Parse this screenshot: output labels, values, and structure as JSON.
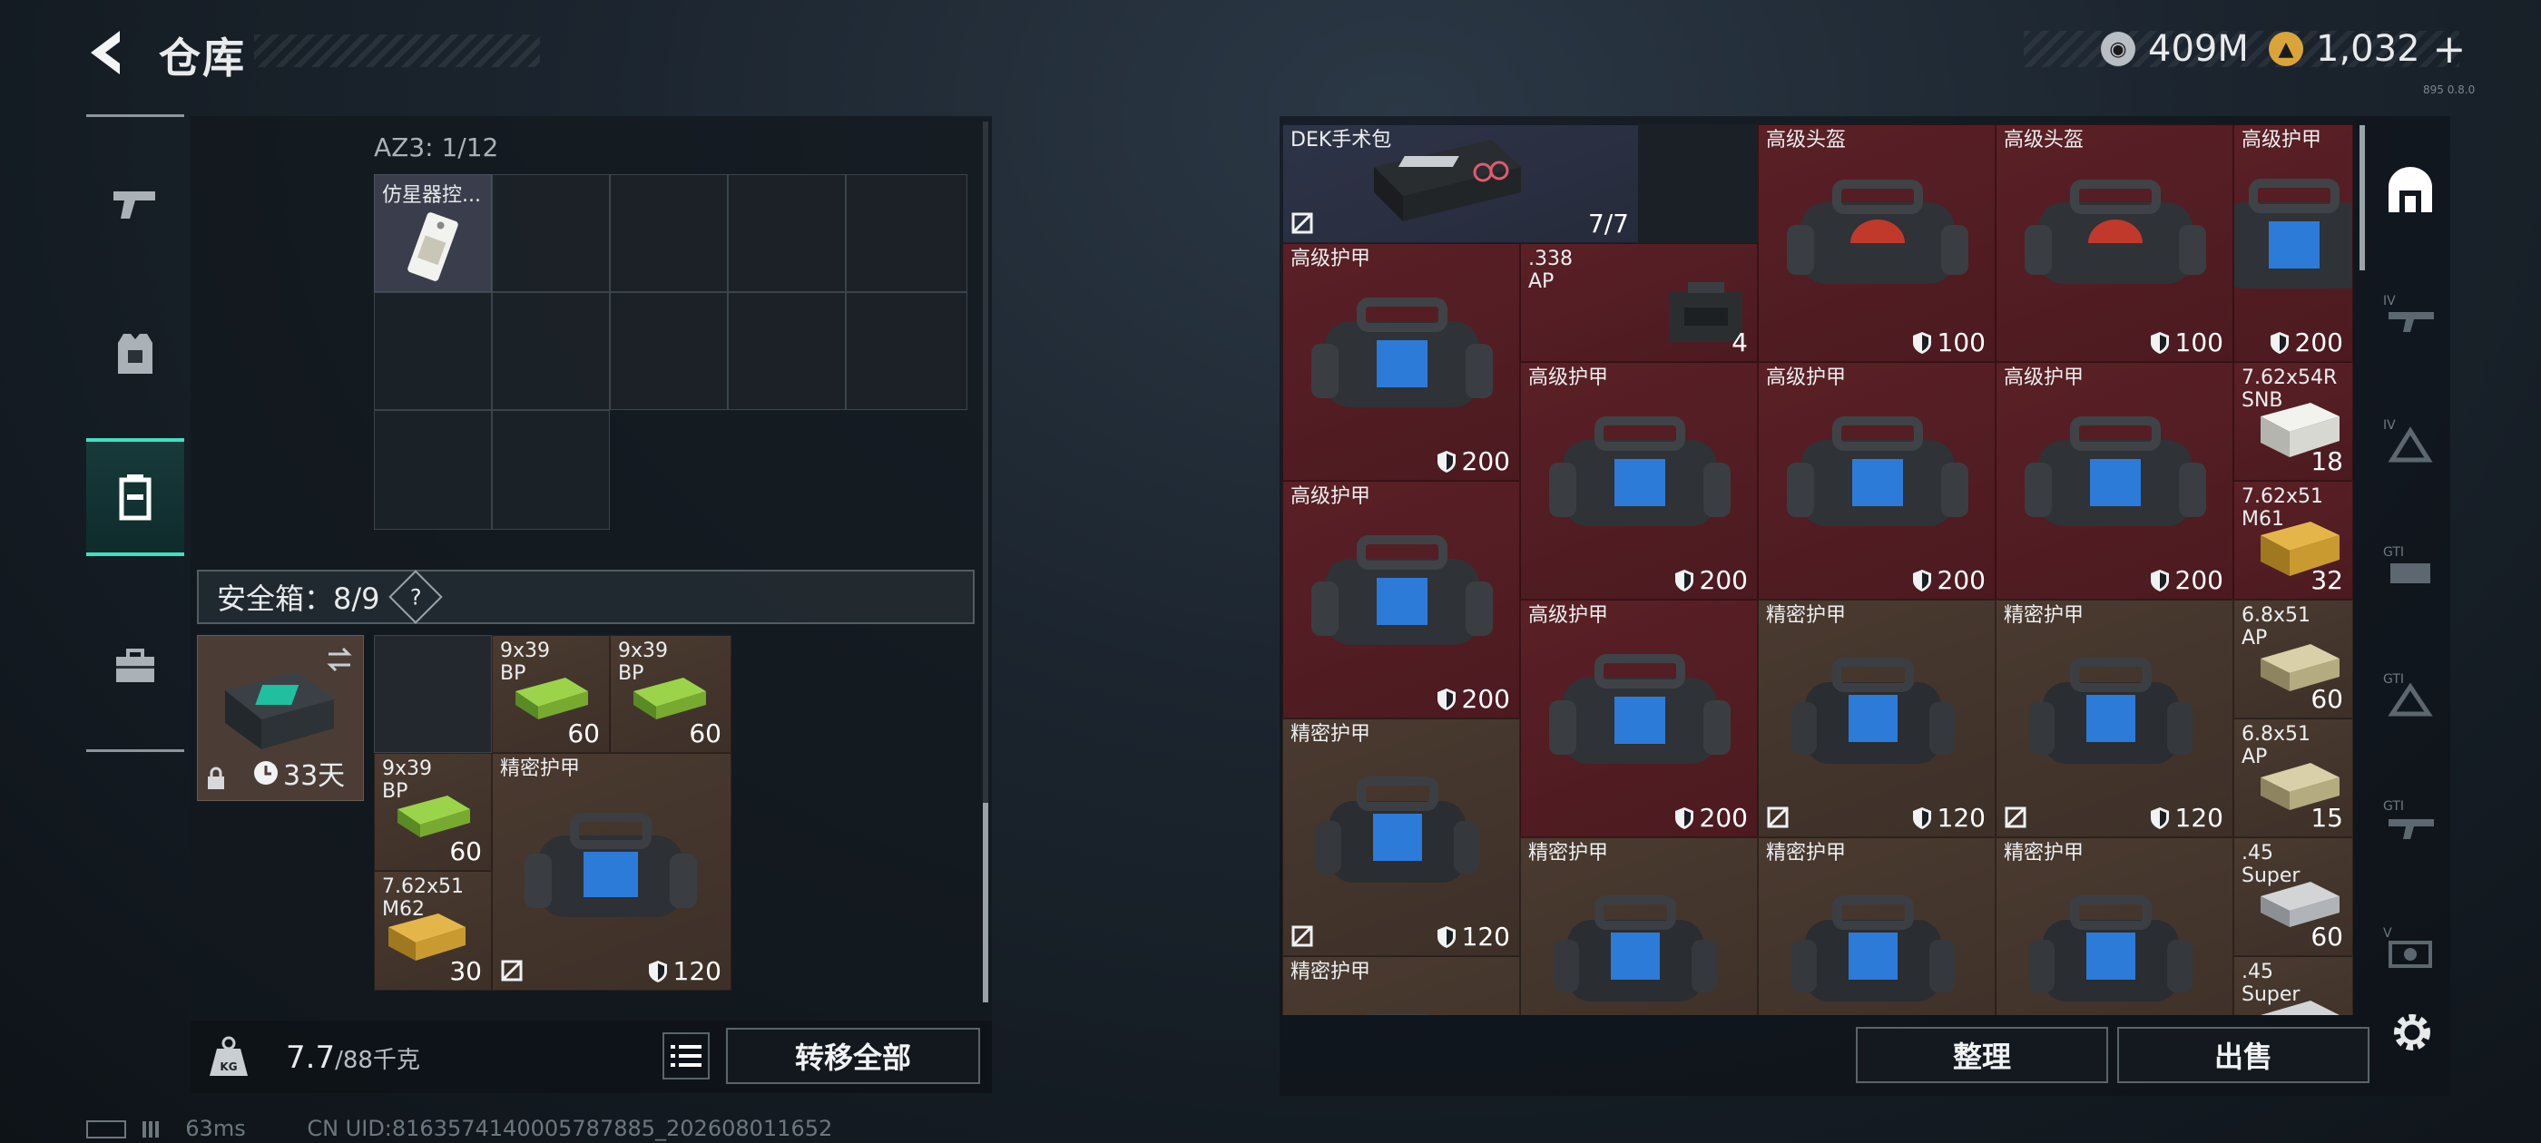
{
  "header": {
    "title": "仓库"
  },
  "currency": {
    "silver": "409M",
    "gold": "1,032",
    "plus": "+",
    "version": "895 0.8.0"
  },
  "container": {
    "label": "AZ3: 1/12",
    "item": {
      "name": "仿星器控..."
    }
  },
  "safe_box": {
    "label": "安全箱：8/9",
    "help": "?",
    "timer": "33天"
  },
  "safe_items": [
    {
      "name": "9x39\nBP",
      "count": "60"
    },
    {
      "name": "9x39\nBP",
      "count": "60"
    },
    {
      "name": "9x39\nBP",
      "count": "60"
    },
    {
      "name": "精密护甲",
      "count": "120"
    },
    {
      "name": "7.62x51\nM62",
      "count": "30"
    }
  ],
  "weight": {
    "current": "7.7",
    "max": "/88千克"
  },
  "buttons": {
    "transfer_all": "转移全部",
    "sort": "整理",
    "sell": "出售"
  },
  "status": {
    "ping": "63ms",
    "uid": "CN UID:8163574140005787885_202608011652"
  },
  "stash_items": [
    {
      "name": "DEK手术包",
      "count": "7/7"
    },
    {
      "name": "高级头盔",
      "value": "100"
    },
    {
      "name": "高级头盔",
      "value": "100"
    },
    {
      "name": "高级护甲",
      "value": "200"
    },
    {
      "name": "高级护甲",
      "value": "200"
    },
    {
      "name": ".338\nAP",
      "count": "4"
    },
    {
      "name": "高级护甲",
      "value": "200"
    },
    {
      "name": "高级护甲",
      "value": "200"
    },
    {
      "name": "高级护甲",
      "value": "200"
    },
    {
      "name": "7.62x54R\nSNB",
      "count": "18"
    },
    {
      "name": "高级护甲",
      "value": "200"
    },
    {
      "name": "7.62x51\nM61",
      "count": "32"
    },
    {
      "name": "高级护甲",
      "value": "200"
    },
    {
      "name": "精密护甲",
      "value": "120"
    },
    {
      "name": "精密护甲",
      "value": "120"
    },
    {
      "name": "6.8x51\nAP",
      "count": "60"
    },
    {
      "name": "精密护甲",
      "value": "120"
    },
    {
      "name": "6.8x51\nAP",
      "count": "15"
    },
    {
      "name": "精密护甲",
      "value": ""
    },
    {
      "name": "精密护甲",
      "value": ""
    },
    {
      "name": "精密护甲",
      "value": ""
    },
    {
      "name": ".45\nSuper",
      "count": "60"
    },
    {
      "name": "精密护甲",
      "value": ""
    },
    {
      "name": ".45\nSuper",
      "count": ""
    }
  ],
  "colors": {
    "accent": "#3fe0c0",
    "red_slot": "#5a2026",
    "brown_slot": "#4a3a30",
    "navy_slot": "#2e3448"
  }
}
